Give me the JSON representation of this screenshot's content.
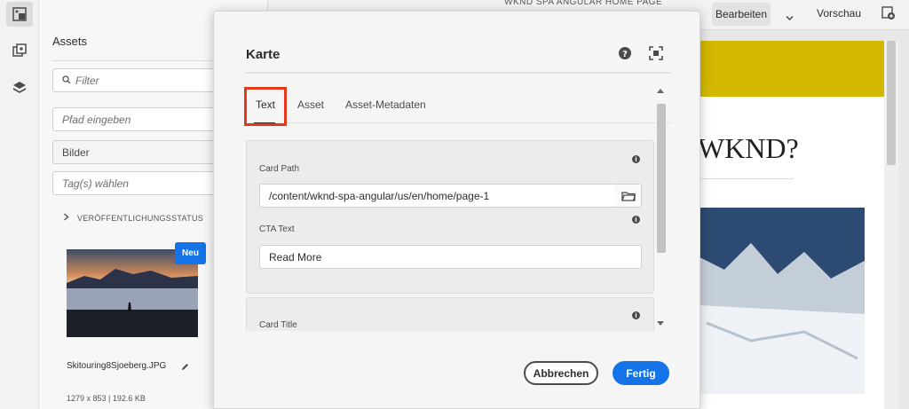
{
  "rail": {
    "icons": [
      "assets-icon",
      "components-icon",
      "content-tree-icon"
    ]
  },
  "assets_panel": {
    "title": "Assets",
    "filter_placeholder": "Filter",
    "path_placeholder": "Pfad eingeben",
    "type_value": "Bilder",
    "tags_placeholder": "Tag(s) wählen",
    "publication_status": "VERÖFFENTLICHUNGSSTATUS",
    "asset": {
      "badge": "Neu",
      "name": "Skitouring8Sjoeberg.JPG",
      "meta": "1279 x 853 | 192.6 KB"
    }
  },
  "topbar": {
    "page_title": "WKND SPA ANGULAR HOME PAGE",
    "edit_label": "Bearbeiten",
    "preview_label": "Vorschau"
  },
  "page": {
    "heading_partial": "WKND?"
  },
  "dialog": {
    "title": "Karte",
    "tabs": [
      {
        "label": "Text",
        "active": true
      },
      {
        "label": "Asset",
        "active": false
      },
      {
        "label": "Asset-Metadaten",
        "active": false
      }
    ],
    "fields": {
      "card_path": {
        "label": "Card Path",
        "value": "/content/wknd-spa-angular/us/en/home/page-1"
      },
      "cta_text": {
        "label": "CTA Text",
        "value": "Read More"
      },
      "card_title": {
        "label": "Card Title"
      }
    },
    "cancel_label": "Abbrechen",
    "done_label": "Fertig"
  },
  "colors": {
    "accent": "#1473e6",
    "highlight": "#e23a1b",
    "banner": "#d2b800"
  }
}
